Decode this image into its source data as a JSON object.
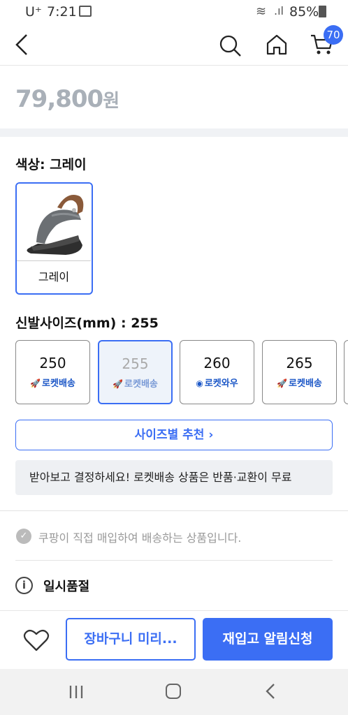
{
  "status_bar": {
    "carrier": "U⁺",
    "time": "7:21",
    "battery": "85%"
  },
  "header": {
    "cart_count": "70"
  },
  "price": {
    "amount": "79,800",
    "unit": "원"
  },
  "color": {
    "label": "색상: 그레이",
    "options": [
      {
        "name": "그레이",
        "selected": true
      }
    ]
  },
  "size": {
    "label": "신발사이즈(mm) : 255",
    "options": [
      {
        "value": "250",
        "badge": "로켓배송",
        "badge_icon": "rocket-icon",
        "selected": false
      },
      {
        "value": "255",
        "badge": "로켓배송",
        "badge_icon": "rocket-icon",
        "selected": true
      },
      {
        "value": "260",
        "badge": "로켓와우",
        "badge_icon": "rocket-wow-icon",
        "selected": false
      },
      {
        "value": "265",
        "badge": "로켓배송",
        "badge_icon": "rocket-icon",
        "selected": false
      }
    ],
    "recommend_label": "사이즈별 추천 ›"
  },
  "notice": "받아보고 결정하세요! 로켓배송 상품은 반품·교환이 무료",
  "direct_purchase": "쿠팡이 직접 매입하여 배송하는 상품입니다.",
  "stock_status": "일시품절",
  "bottom_bar": {
    "cart_button": "장바구니 미리...",
    "notify_button": "재입고 알림신청"
  },
  "colors": {
    "accent": "#3b6ef4",
    "price_gray": "#a9b0b8"
  }
}
